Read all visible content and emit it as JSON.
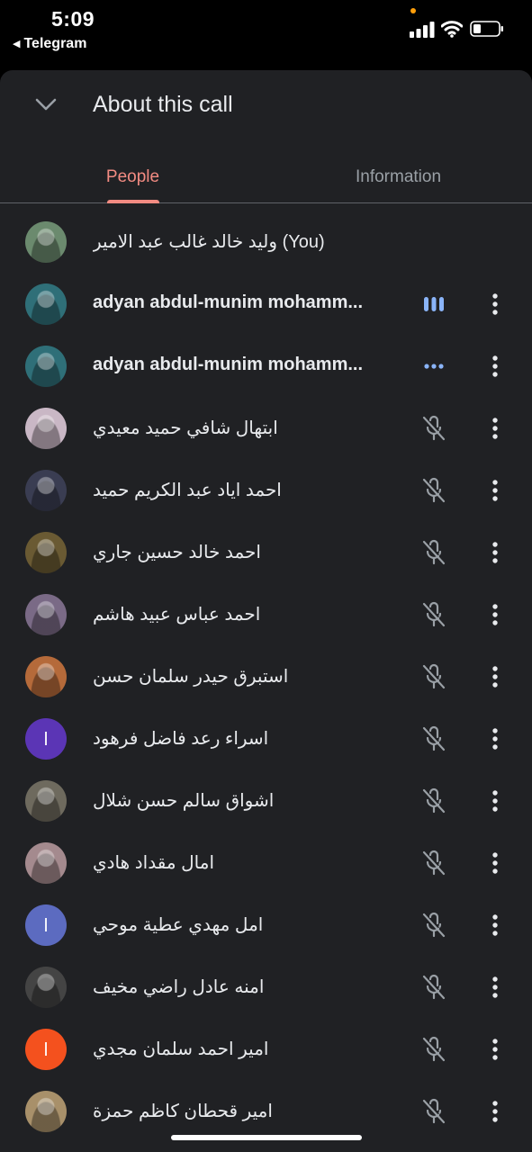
{
  "statusbar": {
    "time": "5:09",
    "back_label": "Telegram",
    "back_icon": "back-triangle-icon"
  },
  "header": {
    "title": "About this call",
    "collapse_icon": "chevron-down-icon"
  },
  "tabs": [
    {
      "label": "People",
      "active": true
    },
    {
      "label": "Information",
      "active": false
    }
  ],
  "colors": {
    "sheet_bg": "#202124",
    "accent": "#f28b82",
    "speaking": "#8ab4f8",
    "muted_icon": "#9aa0a6"
  },
  "participants": [
    {
      "name": "وليد خالد غالب عبد الامير (You)",
      "bold": false,
      "status": "none",
      "avatar": "photo",
      "avatar_color": "#6b8a6e",
      "initial": "",
      "menu": false
    },
    {
      "name": "adyan abdul-munim mohamm...",
      "bold": true,
      "status": "speaking",
      "avatar": "photo",
      "avatar_color": "#2f6f78",
      "initial": "",
      "menu": true
    },
    {
      "name": "adyan abdul-munim mohamm...",
      "bold": true,
      "status": "connecting",
      "avatar": "photo",
      "avatar_color": "#2f6f78",
      "initial": "",
      "menu": true
    },
    {
      "name": "ابتهال شافي حميد معيدي",
      "bold": false,
      "status": "muted",
      "avatar": "photo",
      "avatar_color": "#c9b7c5",
      "initial": "",
      "menu": true
    },
    {
      "name": "احمد اياد عبد الكريم حميد",
      "bold": false,
      "status": "muted",
      "avatar": "photo",
      "avatar_color": "#3a3d52",
      "initial": "",
      "menu": true
    },
    {
      "name": "احمد خالد حسين جاري",
      "bold": false,
      "status": "muted",
      "avatar": "photo",
      "avatar_color": "#6a5a33",
      "initial": "",
      "menu": true
    },
    {
      "name": "احمد عباس عبيد هاشم",
      "bold": false,
      "status": "muted",
      "avatar": "photo",
      "avatar_color": "#7a6a86",
      "initial": "",
      "menu": true
    },
    {
      "name": "استبرق حيدر سلمان حسن",
      "bold": false,
      "status": "muted",
      "avatar": "photo",
      "avatar_color": "#b56a3a",
      "initial": "",
      "menu": true
    },
    {
      "name": "اسراء رعد فاضل فرهود",
      "bold": false,
      "status": "muted",
      "avatar": "letter",
      "avatar_color": "#5b35b5",
      "initial": "ا",
      "menu": true
    },
    {
      "name": "اشواق سالم حسن شلال",
      "bold": false,
      "status": "muted",
      "avatar": "photo",
      "avatar_color": "#6e6a5e",
      "initial": "",
      "menu": true
    },
    {
      "name": "امال مقداد هادي",
      "bold": false,
      "status": "muted",
      "avatar": "photo",
      "avatar_color": "#a48a8e",
      "initial": "",
      "menu": true
    },
    {
      "name": "امل مهدي عطية موحي",
      "bold": false,
      "status": "muted",
      "avatar": "letter",
      "avatar_color": "#5c6bc0",
      "initial": "ا",
      "menu": true
    },
    {
      "name": "امنه عادل راضي مخيف",
      "bold": false,
      "status": "muted",
      "avatar": "photo",
      "avatar_color": "#444444",
      "initial": "",
      "menu": true
    },
    {
      "name": "امير احمد سلمان مجدي",
      "bold": false,
      "status": "muted",
      "avatar": "letter",
      "avatar_color": "#f4511e",
      "initial": "ا",
      "menu": true
    },
    {
      "name": "امير قحطان كاظم حمزة",
      "bold": false,
      "status": "muted",
      "avatar": "photo",
      "avatar_color": "#a8906a",
      "initial": "",
      "menu": true
    }
  ]
}
